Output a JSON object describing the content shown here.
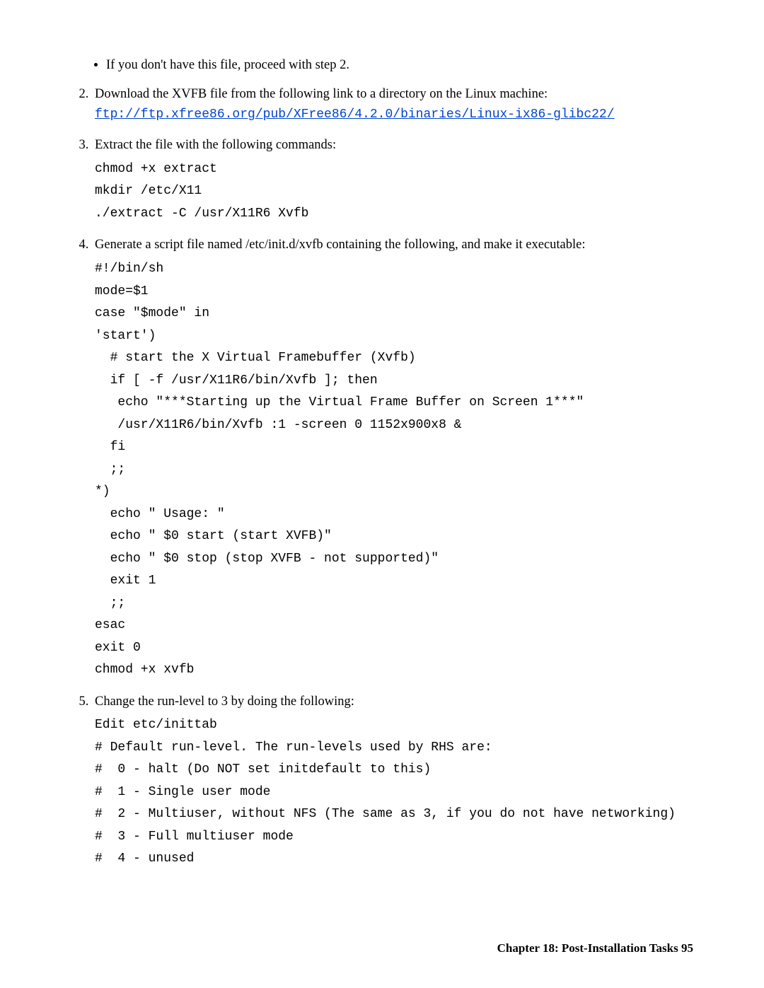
{
  "bullet1": "If you don't have this file, proceed with step 2.",
  "step2_text": "Download the XVFB file from the following link to a directory on the Linux machine:",
  "step2_link": "ftp://ftp.xfree86.org/pub/XFree86/4.2.0/binaries/Linux-ix86-glibc22/",
  "step3_text": "Extract the file with the following commands:",
  "step3_code1": "chmod +x extract",
  "step3_code2": "mkdir /etc/X11",
  "step3_code3": "./extract -C /usr/X11R6 Xvfb",
  "step4_text": "Generate a script file named /etc/init.d/xvfb containing the following, and make it executable:",
  "step4_code": "#!/bin/sh\nmode=$1\ncase \"$mode\" in\n'start')\n  # start the X Virtual Framebuffer (Xvfb)\n  if [ -f /usr/X11R6/bin/Xvfb ]; then\n   echo \"***Starting up the Virtual Frame Buffer on Screen 1***\"\n   /usr/X11R6/bin/Xvfb :1 -screen 0 1152x900x8 &\n  fi\n  ;;\n*)\n  echo \" Usage: \"\n  echo \" $0 start (start XVFB)\"\n  echo \" $0 stop (stop XVFB - not supported)\"\n  exit 1\n  ;;\nesac\nexit 0\nchmod +x xvfb",
  "step5_text": "Change the run-level to 3 by doing the following:",
  "step5_code": "Edit etc/inittab\n# Default run-level. The run-levels used by RHS are:\n#  0 - halt (Do NOT set initdefault to this)\n#  1 - Single user mode\n#  2 - Multiuser, without NFS (The same as 3, if you do not have networking)\n#  3 - Full multiuser mode\n#  4 - unused",
  "footer_chapter": "Chapter 18: Post-Installation Tasks",
  "footer_page": "95"
}
